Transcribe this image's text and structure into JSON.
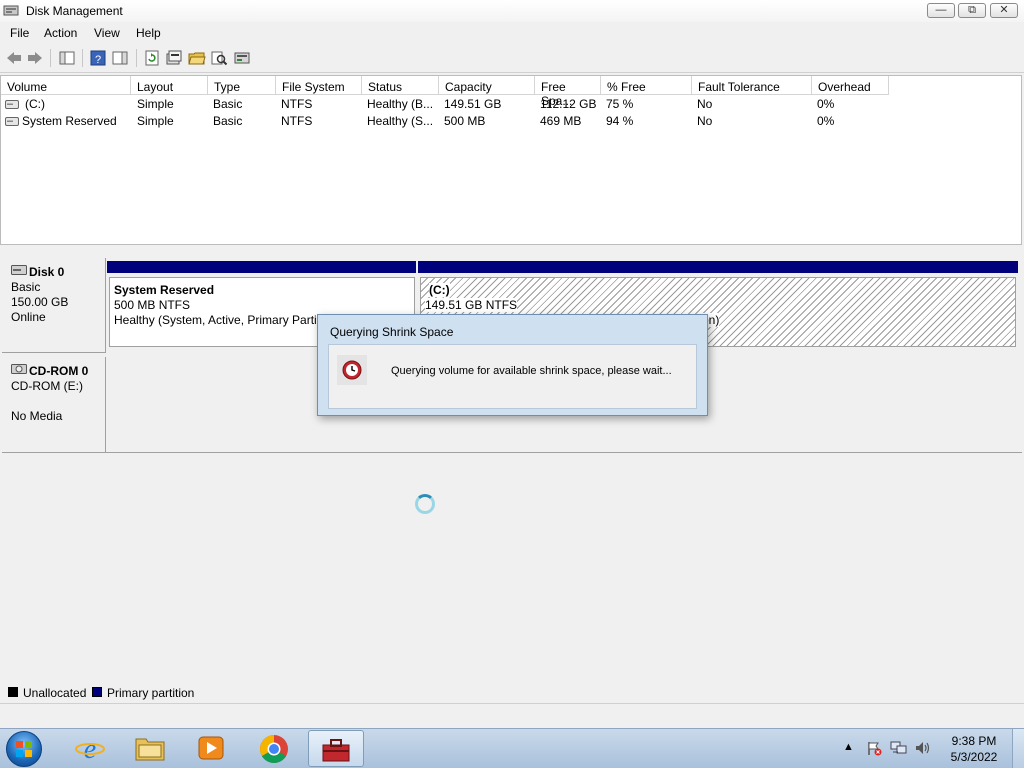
{
  "window": {
    "title": "Disk Management",
    "minimize": "—",
    "maximize": "⧉",
    "close": "✕"
  },
  "menu": [
    "File",
    "Action",
    "View",
    "Help"
  ],
  "volume_list": {
    "columns": [
      "Volume",
      "Layout",
      "Type",
      "File System",
      "Status",
      "Capacity",
      "Free Spa...",
      "% Free",
      "Fault Tolerance",
      "Overhead"
    ],
    "rows": [
      {
        "volume": "(C:)",
        "layout": "Simple",
        "type": "Basic",
        "fs": "NTFS",
        "status": "Healthy (B...",
        "capacity": "149.51 GB",
        "free": "112.12 GB",
        "pct_free": "75 %",
        "fault": "No",
        "overhead": "0%"
      },
      {
        "volume": "System Reserved",
        "layout": "Simple",
        "type": "Basic",
        "fs": "NTFS",
        "status": "Healthy (S...",
        "capacity": "500 MB",
        "free": "469 MB",
        "pct_free": "94 %",
        "fault": "No",
        "overhead": "0%"
      }
    ]
  },
  "disks": [
    {
      "name": "Disk 0",
      "type": "Basic",
      "size": "150.00 GB",
      "status": "Online",
      "partitions": [
        {
          "name": "System Reserved",
          "size": "500 MB NTFS",
          "status": "Healthy (System, Active, Primary Partiti"
        },
        {
          "name": "(C:)",
          "size": "149.51 GB NTFS",
          "status": "on)"
        }
      ]
    },
    {
      "name": "CD-ROM 0",
      "type": "CD-ROM (E:)",
      "status": "No Media"
    }
  ],
  "legend": [
    {
      "label": "Unallocated",
      "color": "#000000"
    },
    {
      "label": "Primary partition",
      "color": "#00007c"
    }
  ],
  "dialog": {
    "title": "Querying Shrink Space",
    "message": "Querying volume for available shrink space, please wait..."
  },
  "taskbar": {
    "time": "9:38 PM",
    "date": "5/3/2022"
  }
}
